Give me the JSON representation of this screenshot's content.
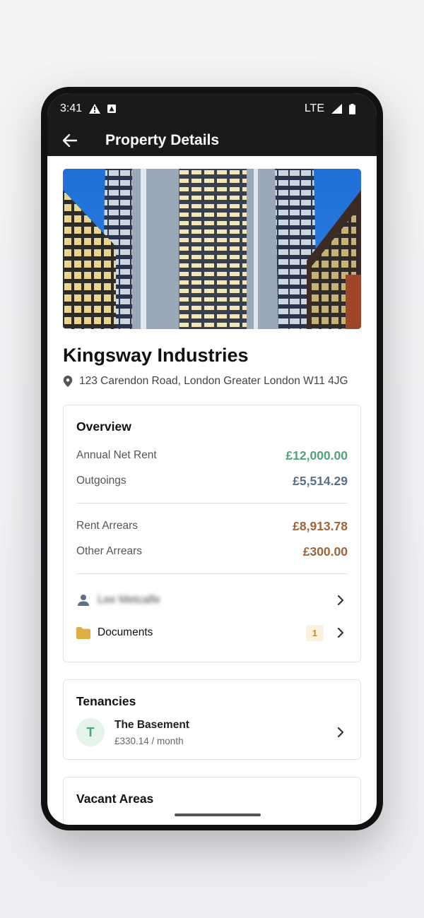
{
  "status_bar": {
    "time": "3:41",
    "network": "LTE"
  },
  "app_bar": {
    "title": "Property Details"
  },
  "property": {
    "name": "Kingsway Industries",
    "address": "123 Carendon Road, London Greater London W11 4JG"
  },
  "overview": {
    "title": "Overview",
    "rows": [
      {
        "label": "Annual Net Rent",
        "value": "£12,000.00",
        "color": "#4fa578"
      },
      {
        "label": "Outgoings",
        "value": "£5,514.29",
        "color": "#5b7085"
      },
      {
        "label": "Rent Arrears",
        "value": "£8,913.78",
        "color": "#a0643a"
      },
      {
        "label": "Other Arrears",
        "value": "£300.00",
        "color": "#a0643a"
      }
    ],
    "contact_name": "Lee Metcalfe",
    "documents_label": "Documents",
    "documents_count": "1"
  },
  "tenancies": {
    "title": "Tenancies",
    "items": [
      {
        "initial": "T",
        "name": "The Basement",
        "rent": "£330.14 / month"
      }
    ]
  },
  "vacant_areas": {
    "title": "Vacant Areas"
  },
  "colors": {
    "folder": "#dcae43",
    "person": "#5b7085",
    "bar": "#1a1a1a"
  }
}
